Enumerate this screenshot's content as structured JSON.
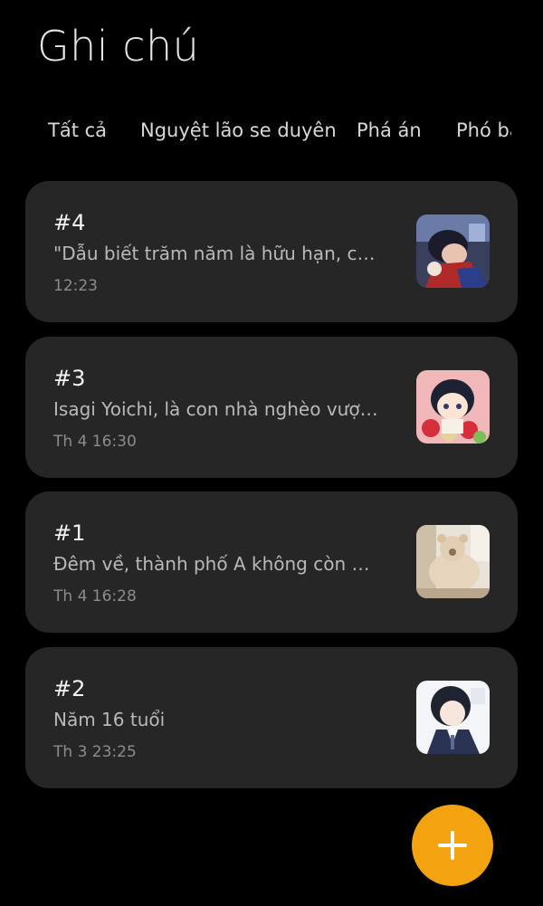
{
  "header": {
    "title": "Ghi chú"
  },
  "tabs": [
    {
      "label": "Tất cả"
    },
    {
      "label": "Nguyệt lão se duyên"
    },
    {
      "label": "Phá án"
    },
    {
      "label": "Phó bản"
    }
  ],
  "notes": [
    {
      "title": "#4",
      "preview": "\"Dẫu biết trăm năm là hữu hạn, cớ s...",
      "time": "12:23",
      "thumbnail": "anime-boy-red-thumbnail"
    },
    {
      "title": "#3",
      "preview": "Isagi Yoichi, là con nhà nghèo vượt ...",
      "time": "Th 4 16:30",
      "thumbnail": "chibi-boy-strawberry-thumbnail"
    },
    {
      "title": "#1",
      "preview": "Đêm về, thành phố A không còn vẻ ...",
      "time": "Th 4 16:28",
      "thumbnail": "teddy-bear-chair-thumbnail"
    },
    {
      "title": "#2",
      "preview": "Năm 16 tuổi",
      "time": "Th 3 23:25",
      "thumbnail": "anime-boy-uniform-thumbnail"
    }
  ],
  "fab": {
    "icon": "plus-icon",
    "color": "#f2a30f"
  },
  "colors": {
    "background": "#000000",
    "card": "#262626",
    "accent": "#f2a30f"
  }
}
